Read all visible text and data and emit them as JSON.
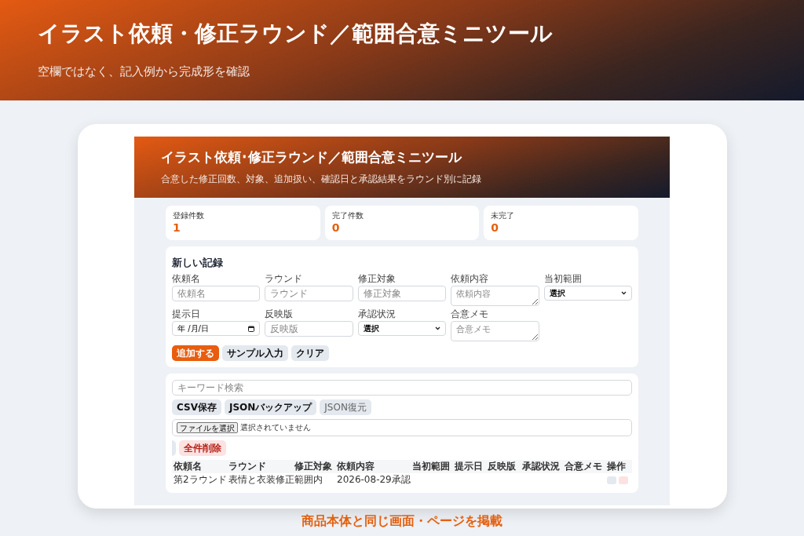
{
  "banner": {
    "title": "イラスト依頼・修正ラウンド／範囲合意ミニツール",
    "subtitle": "空欄ではなく、記入例から完成形を確認"
  },
  "screen": {
    "header": {
      "title": "イラスト依頼･修正ラウンド／範囲合意ミニツール",
      "subtitle": "合意した修正回数、対象、追加扱い、確認日と承認結果をラウンド別に記録"
    },
    "stats": [
      {
        "label": "登録件数",
        "value": "1"
      },
      {
        "label": "完了件数",
        "value": "0"
      },
      {
        "label": "未完了",
        "value": "0"
      }
    ],
    "form": {
      "title": "新しい記録",
      "fields": [
        {
          "label": "依頼名",
          "kind": "text",
          "placeholder": "依頼名"
        },
        {
          "label": "ラウンド",
          "kind": "text",
          "placeholder": "ラウンド"
        },
        {
          "label": "修正対象",
          "kind": "text",
          "placeholder": "修正対象"
        },
        {
          "label": "依頼内容",
          "kind": "textarea",
          "placeholder": "依頼内容"
        },
        {
          "label": "当初範囲",
          "kind": "select",
          "value": "選択"
        },
        {
          "label": "提示日",
          "kind": "date",
          "value": "年 /月/日"
        },
        {
          "label": "反映版",
          "kind": "text",
          "placeholder": "反映版"
        },
        {
          "label": "承認状況",
          "kind": "select",
          "value": "選択"
        },
        {
          "label": "合意メモ",
          "kind": "textarea",
          "placeholder": "合意メモ"
        }
      ],
      "buttons": [
        {
          "label": "追加する",
          "kind": "primary"
        },
        {
          "label": "サンプル入力",
          "kind": "secondary"
        },
        {
          "label": "クリア",
          "kind": "secondary"
        }
      ]
    },
    "tools": {
      "search": {
        "placeholder": "キーワード検索"
      },
      "buttons": [
        {
          "label": "CSV保存",
          "kind": "secondary"
        },
        {
          "label": "JSONバックアップ",
          "kind": "secondary"
        },
        {
          "label": "JSON復元",
          "kind": "faded"
        }
      ],
      "file": {
        "button": "ファイルを選択",
        "status": "選択されていません"
      },
      "danger_button": "全件削除",
      "table": {
        "columns": [
          "依頼名",
          "ラウンド",
          "修正対象",
          "依頼内容",
          "当初範囲",
          "提示日",
          "反映版",
          "承認状況",
          "合意メモ",
          "操作"
        ],
        "rows": [
          [
            "第2ラウンド",
            "表情と衣装修正",
            "範囲内",
            "2026-08-29承認",
            "",
            "",
            "",
            "",
            "",
            ""
          ]
        ]
      }
    }
  },
  "caption": "商品本体と同じ画面・ページを掲載"
}
